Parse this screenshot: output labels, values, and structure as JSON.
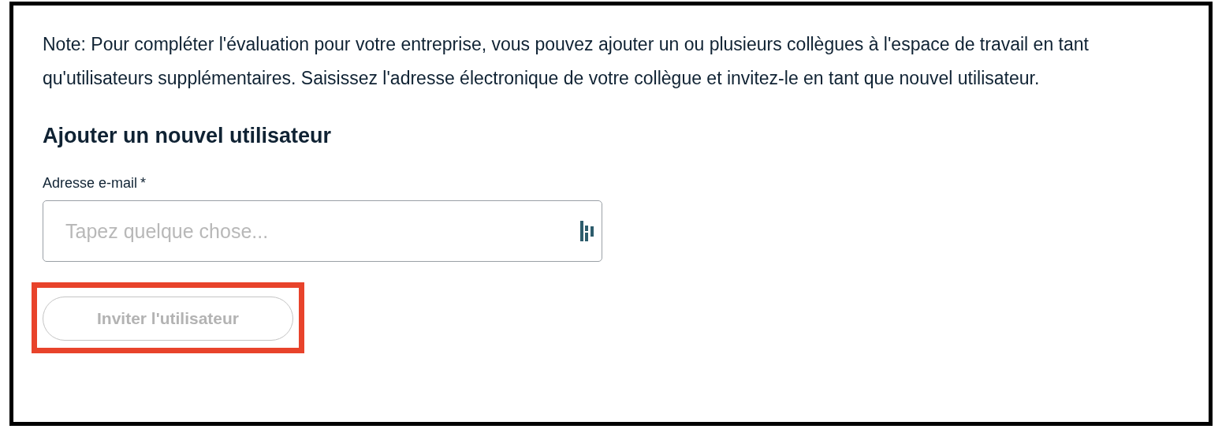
{
  "note": "Note: Pour compléter l'évaluation pour votre entreprise, vous pouvez ajouter un ou plusieurs collègues à l'espace de travail en tant qu'utilisateurs supplémentaires. Saisissez l'adresse électronique de votre collègue et invitez-le en tant que nouvel utilisateur.",
  "heading": "Ajouter un nouvel utilisateur",
  "email_field": {
    "label": "Adresse e-mail",
    "required_mark": "*",
    "placeholder": "Tapez quelque chose..."
  },
  "invite_button": {
    "label": "Inviter l'utilisateur",
    "disabled": true,
    "highlighted": true
  }
}
